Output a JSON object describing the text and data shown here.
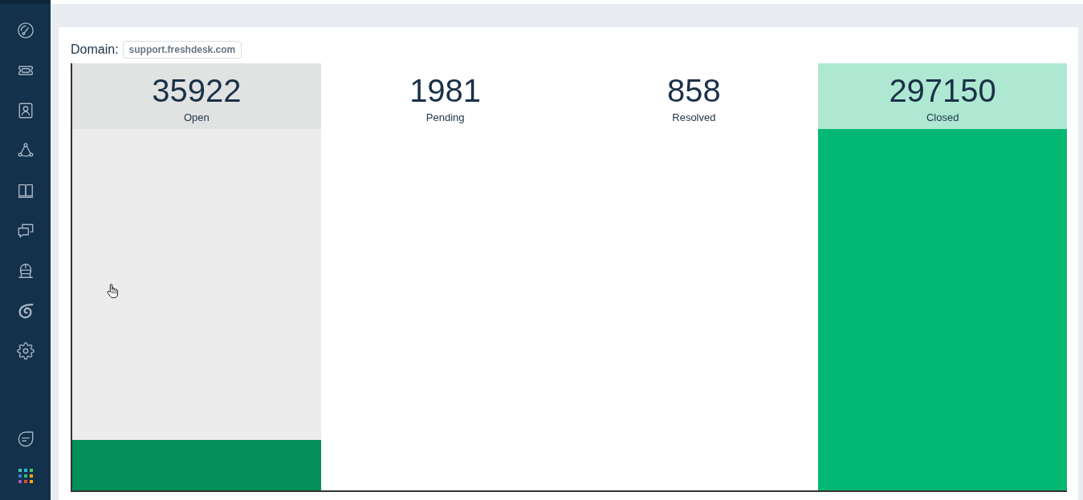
{
  "domain": {
    "label": "Domain:",
    "value": "support.freshdesk.com"
  },
  "columns": [
    {
      "count": "35922",
      "label": "Open",
      "hovered": true,
      "level": 0.14,
      "color": "#038e5a"
    },
    {
      "count": "1981",
      "label": "Pending",
      "hovered": false
    },
    {
      "count": "858",
      "label": "Resolved",
      "hovered": false
    },
    {
      "count": "297150",
      "label": "Closed",
      "hovered": false,
      "level": 1,
      "color": "#03b873"
    }
  ]
}
